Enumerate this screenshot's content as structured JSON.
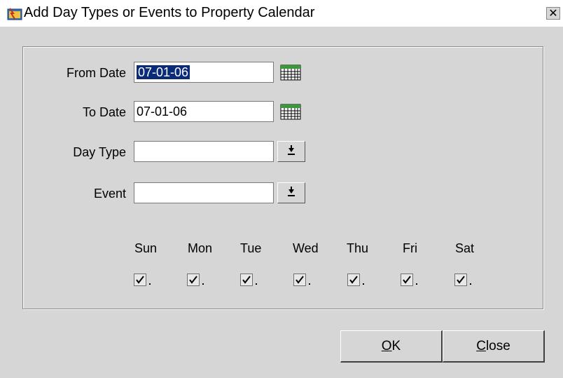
{
  "window": {
    "title": "Add Day Types or Events to Property Calendar",
    "close_glyph": "✕"
  },
  "form": {
    "from_date_label": "From Date",
    "from_date_value": "07-01-06",
    "to_date_label": "To Date",
    "to_date_value": "07-01-06",
    "day_type_label": "Day Type",
    "day_type_value": "",
    "event_label": "Event",
    "event_value": ""
  },
  "days": [
    {
      "label": "Sun",
      "checked": true
    },
    {
      "label": "Mon",
      "checked": true
    },
    {
      "label": "Tue",
      "checked": true
    },
    {
      "label": "Wed",
      "checked": true
    },
    {
      "label": "Thu",
      "checked": true
    },
    {
      "label": "Fri",
      "checked": true
    },
    {
      "label": "Sat",
      "checked": true
    }
  ],
  "buttons": {
    "ok_mnemonic": "O",
    "ok_rest": "K",
    "close_mnemonic": "C",
    "close_rest": "lose"
  },
  "colors": {
    "dialog_bg": "#d6d6d6",
    "selection_bg": "#0a2a7a",
    "calendar_green": "#3a9a3a"
  },
  "icons": {
    "title": "app-window-icon",
    "calendar": "calendar-icon",
    "dropdown": "dropdown-arrow-icon",
    "check": "checkmark-icon"
  }
}
